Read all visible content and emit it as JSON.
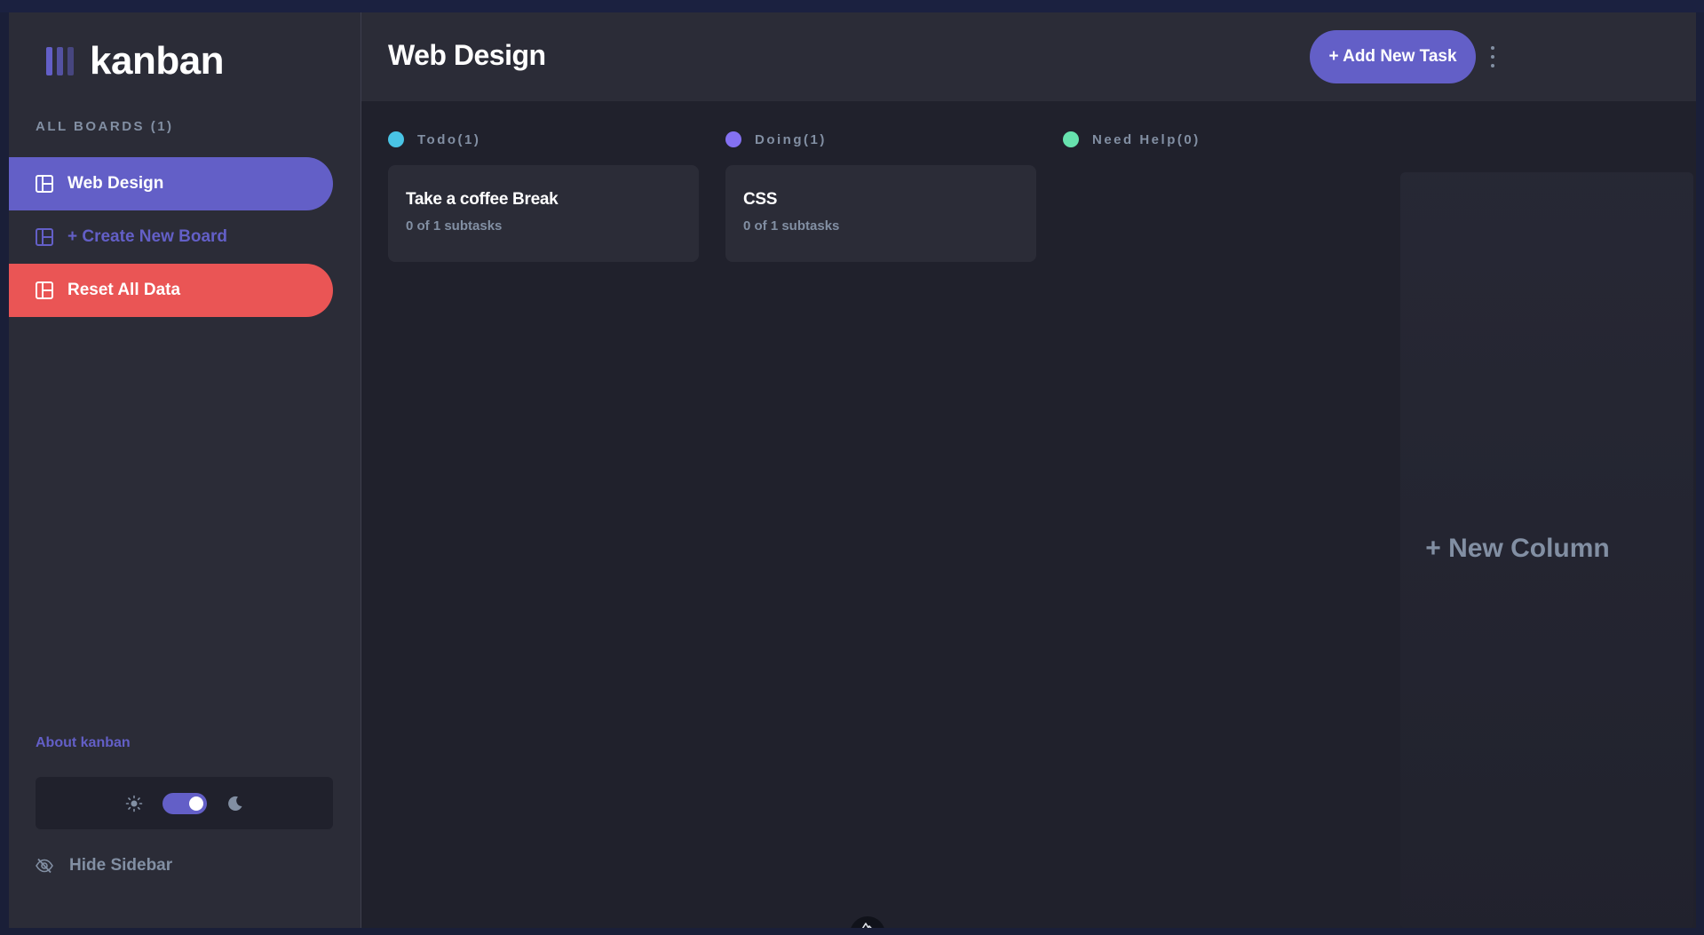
{
  "app": {
    "logo_text": "kanban",
    "accent_color": "#635fc7",
    "danger_color": "#ea5555"
  },
  "sidebar": {
    "boards_heading": "ALL BOARDS (1)",
    "items": [
      {
        "label": "Web Design",
        "state": "active",
        "icon": "board-icon"
      },
      {
        "label": "+ Create New Board",
        "state": "link",
        "icon": "board-icon"
      },
      {
        "label": "Reset All Data",
        "state": "danger",
        "icon": "board-icon"
      }
    ],
    "about_link": "About kanban",
    "theme": {
      "light_icon": "sun-icon",
      "dark_icon": "moon-icon",
      "mode": "dark"
    },
    "hide_label": "Hide Sidebar"
  },
  "header": {
    "title": "Web Design",
    "add_task_label": "+ Add New Task",
    "menu_icon": "kebab-menu-icon"
  },
  "board": {
    "columns": [
      {
        "title": "Todo(1)",
        "color": "#49c4e5",
        "tasks": [
          {
            "title": "Take a coffee Break",
            "subtasks": "0 of 1 subtasks"
          }
        ]
      },
      {
        "title": "Doing(1)",
        "color": "#8471f2",
        "tasks": [
          {
            "title": "CSS",
            "subtasks": "0 of 1 subtasks"
          }
        ]
      },
      {
        "title": "Need Help(0)",
        "color": "#67e2ae",
        "tasks": []
      }
    ],
    "new_column_label": "+ New Column"
  }
}
